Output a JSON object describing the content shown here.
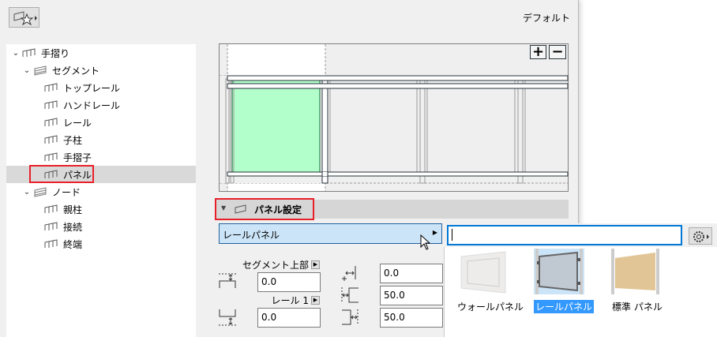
{
  "header": {
    "preset": "デフォルト"
  },
  "tree": [
    {
      "label": "手摺り",
      "level": 0,
      "expanded": true
    },
    {
      "label": "セグメント",
      "level": 1,
      "expanded": true
    },
    {
      "label": "トップレール",
      "level": 2
    },
    {
      "label": "ハンドレール",
      "level": 2
    },
    {
      "label": "レール",
      "level": 2
    },
    {
      "label": "子柱",
      "level": 2
    },
    {
      "label": "手摺子",
      "level": 2
    },
    {
      "label": "パネル",
      "level": 2,
      "selected": true
    },
    {
      "label": "ノード",
      "level": 1,
      "expanded": true
    },
    {
      "label": "親柱",
      "level": 2
    },
    {
      "label": "接続",
      "level": 2
    },
    {
      "label": "終端",
      "level": 2
    }
  ],
  "section": {
    "title": "パネル設定"
  },
  "panel_type": {
    "value": "レールパネル"
  },
  "fields": {
    "segment_top_label": "セグメント上部",
    "segment_top_value": "0.0",
    "rail1_label": "レール 1",
    "rail1_value": "0.0",
    "offset_value": "0.0",
    "left_gap_value": "50.0",
    "right_gap_value": "50.0"
  },
  "popup": {
    "search_value": "",
    "items": [
      {
        "label": "ウォールパネル",
        "selected": false
      },
      {
        "label": "レールパネル",
        "selected": true
      },
      {
        "label": "標準 パネル",
        "selected": false
      }
    ]
  },
  "colors": {
    "accent": "#0078d7",
    "selection": "#3399ff",
    "highlight_red": "#e8202a",
    "panel_green": "#b3ffcc"
  }
}
